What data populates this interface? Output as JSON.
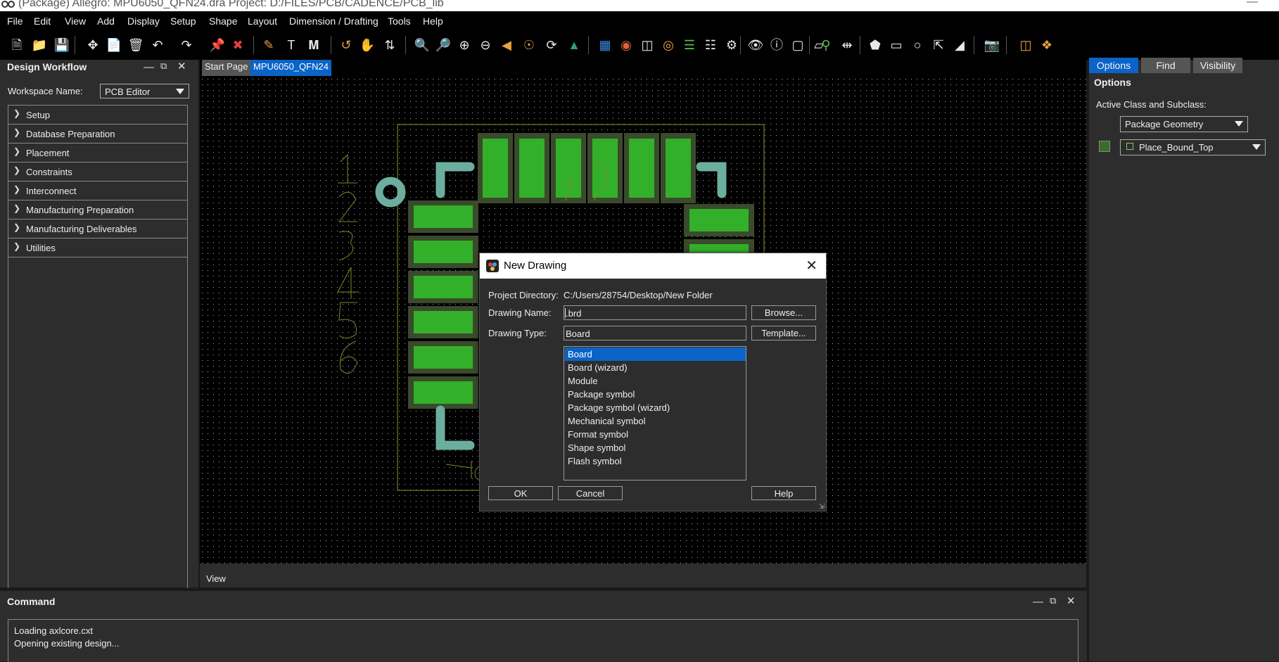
{
  "window": {
    "title": "(Package) Allegro: MPU6050_QFN24.dra  Project: D:/FILES/PCB/CADENCE/PCB_lib"
  },
  "menu": [
    "File",
    "Edit",
    "View",
    "Add",
    "Display",
    "Setup",
    "Shape",
    "Layout",
    "Dimension / Drafting",
    "Tools",
    "Help"
  ],
  "workflow": {
    "title": "Design Workflow",
    "workspace_label": "Workspace Name:",
    "workspace_value": "PCB Editor",
    "items": [
      "Setup",
      "Database Preparation",
      "Placement",
      "Constraints",
      "Interconnect",
      "Manufacturing Preparation",
      "Manufacturing Deliverables",
      "Utilities"
    ]
  },
  "tabs": [
    "Start Page",
    "MPU6050_QFN24"
  ],
  "status": {
    "view_label": "View"
  },
  "right_panel": {
    "tabs": [
      "Options",
      "Find",
      "Visibility"
    ],
    "title": "Options",
    "class_label": "Active Class and Subclass:",
    "class_value": "Package Geometry",
    "subclass_value": "Place_Bound_Top",
    "swatch_color": "#3d6b2a"
  },
  "command": {
    "title": "Command",
    "lines": [
      "Loading axlcore.cxt",
      "Opening existing design..."
    ]
  },
  "dialog": {
    "title": "New Drawing",
    "project_dir_label": "Project Directory:",
    "project_dir_value": "C:/Users/28754/Desktop/New Folder",
    "drawing_name_label": "Drawing Name:",
    "drawing_name_value": ".brd",
    "drawing_type_label": "Drawing Type:",
    "drawing_type_value": "Board",
    "browse_label": "Browse...",
    "template_label": "Template...",
    "types": [
      "Board",
      "Board (wizard)",
      "Module",
      "Package symbol",
      "Package symbol (wizard)",
      "Mechanical symbol",
      "Format symbol",
      "Shape symbol",
      "Flash symbol"
    ],
    "selected_index": 0,
    "ok_label": "OK",
    "cancel_label": "Cancel",
    "help_label": "Help"
  },
  "colors": {
    "accent": "#0a64c8",
    "pad_green": "#33b02a",
    "pad_outline": "#3a4a2c",
    "silkscreen": "#6cae9e",
    "trace_olive": "#8a9a2a"
  }
}
